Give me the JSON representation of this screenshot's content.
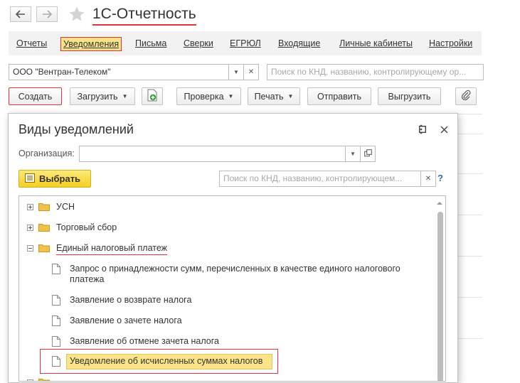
{
  "titlebar": {
    "title": "1С-Отчетность"
  },
  "menu": {
    "items": [
      {
        "label": "Отчеты",
        "active": false
      },
      {
        "label": "Уведомления",
        "active": true
      },
      {
        "label": "Письма",
        "active": false
      },
      {
        "label": "Сверки",
        "active": false
      },
      {
        "label": "ЕГРЮЛ",
        "active": false
      },
      {
        "label": "Входящие",
        "active": false
      },
      {
        "label": "Личные кабинеты",
        "active": false
      },
      {
        "label": "Настройки",
        "active": false
      }
    ]
  },
  "filters": {
    "organization_value": "ООО \"Вентран-Телеком\"",
    "search_placeholder": "Поиск по КНД, названию, контролирующему ор..."
  },
  "toolbar": {
    "create": "Создать",
    "load": "Загрузить",
    "check": "Проверка",
    "print": "Печать",
    "send": "Отправить",
    "export": "Выгрузить"
  },
  "dialog": {
    "title": "Виды уведомлений",
    "org_label": "Организация:",
    "org_value": "",
    "pick_button": "Выбрать",
    "search_placeholder": "Поиск по КНД, названию, контролирующем...",
    "help": "?",
    "tree": [
      {
        "type": "group",
        "label": "УСН",
        "expanded": false
      },
      {
        "type": "group",
        "label": "Торговый сбор",
        "expanded": false
      },
      {
        "type": "group",
        "label": "Единый налоговый платеж",
        "expanded": true
      },
      {
        "type": "item",
        "label": "Запрос о принадлежности сумм, перечисленных в качестве единого налогового",
        "label2": "платежа"
      },
      {
        "type": "item",
        "label": "Заявление о возврате налога"
      },
      {
        "type": "item",
        "label": "Заявление о зачете налога"
      },
      {
        "type": "item",
        "label": "Заявление об отмене зачета налога"
      },
      {
        "type": "item",
        "label": "Уведомление об исчисленных суммах налогов",
        "selected": true
      }
    ]
  },
  "colors": {
    "accent_red": "#e0343f",
    "highlight_yellow": "#fbe488",
    "button_yellow": "#f5cf22",
    "folder": "#f0c24a"
  }
}
